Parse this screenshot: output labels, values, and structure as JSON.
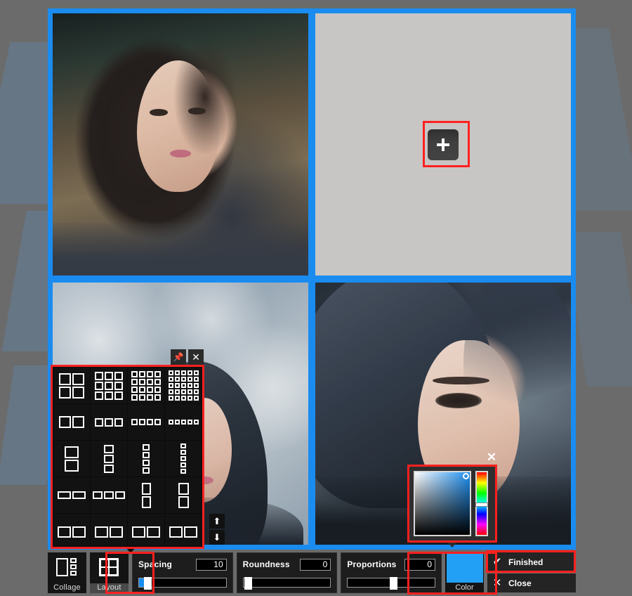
{
  "app": {
    "canvas_bg": "#6b6b6b",
    "spacing_color": "#1a8cf0",
    "highlight_color": "#ff2020"
  },
  "collage": {
    "cells": [
      {
        "name": "photo-portrait-warm",
        "filled": true
      },
      {
        "name": "empty-slot",
        "filled": false,
        "add_label": "+"
      },
      {
        "name": "photo-hooded-wall",
        "filled": true
      },
      {
        "name": "photo-hooded-closeup",
        "filled": true
      }
    ]
  },
  "toolbar": {
    "collage": {
      "label": "Collage",
      "icon": "collage-icon",
      "selected": false
    },
    "layout": {
      "label": "Layout",
      "icon": "layout-grid-icon",
      "selected": true
    },
    "sliders": [
      {
        "name": "spacing",
        "label": "Spacing",
        "value": "10",
        "fill_pct": 4,
        "thumb_pct": 4
      },
      {
        "name": "roundness",
        "label": "Roundness",
        "value": "0",
        "fill_pct": 0,
        "thumb_pct": 0
      },
      {
        "name": "proportions",
        "label": "Proportions",
        "value": "0",
        "fill_pct": 0,
        "thumb_pct": 50
      }
    ],
    "color": {
      "label": "Color",
      "swatch": "#22a0f5"
    },
    "finished": {
      "label": "Finished",
      "glyph": "✔"
    },
    "close": {
      "label": "Close",
      "glyph": "✕"
    }
  },
  "layout_popup": {
    "pin_glyph": "📌",
    "close_glyph": "✕",
    "scroll_up_glyph": "⬆",
    "scroll_down_glyph": "⬇",
    "templates": [
      {
        "name": "grid-2x2",
        "cols": 2,
        "rows": 2,
        "cw": 17,
        "ch": 17
      },
      {
        "name": "grid-3x3",
        "cols": 3,
        "rows": 3,
        "cw": 12,
        "ch": 12
      },
      {
        "name": "grid-4x4",
        "cols": 4,
        "rows": 4,
        "cw": 9,
        "ch": 9
      },
      {
        "name": "grid-5x5",
        "cols": 5,
        "rows": 5,
        "cw": 7,
        "ch": 7
      },
      {
        "name": "cols-2",
        "cols": 2,
        "rows": 1,
        "cw": 17,
        "ch": 17
      },
      {
        "name": "cols-3",
        "cols": 3,
        "rows": 1,
        "cw": 12,
        "ch": 12
      },
      {
        "name": "cols-4",
        "cols": 4,
        "rows": 1,
        "cw": 9,
        "ch": 9
      },
      {
        "name": "cols-5",
        "cols": 5,
        "rows": 1,
        "cw": 7,
        "ch": 7
      },
      {
        "name": "rows-2",
        "cols": 1,
        "rows": 2,
        "cw": 20,
        "ch": 17
      },
      {
        "name": "rows-3",
        "cols": 1,
        "rows": 3,
        "cw": 14,
        "ch": 12
      },
      {
        "name": "rows-4",
        "cols": 1,
        "rows": 4,
        "cw": 10,
        "ch": 9
      },
      {
        "name": "rows-5",
        "cols": 1,
        "rows": 5,
        "cw": 8,
        "ch": 7
      },
      {
        "name": "wide-cols-2",
        "cols": 2,
        "rows": 1,
        "cw": 19,
        "ch": 11
      },
      {
        "name": "wide-cols-3",
        "cols": 3,
        "rows": 1,
        "cw": 14,
        "ch": 11
      },
      {
        "name": "tall-rows-2",
        "cols": 1,
        "rows": 2,
        "cw": 13,
        "ch": 17
      },
      {
        "name": "tall-rows-2b",
        "cols": 1,
        "rows": 2,
        "cw": 15,
        "ch": 17
      },
      {
        "name": "partial-a",
        "cols": 2,
        "rows": 1,
        "cw": 19,
        "ch": 16
      },
      {
        "name": "partial-b",
        "cols": 2,
        "rows": 1,
        "cw": 19,
        "ch": 16
      },
      {
        "name": "partial-c",
        "cols": 2,
        "rows": 1,
        "cw": 19,
        "ch": 16
      },
      {
        "name": "partial-d",
        "cols": 2,
        "rows": 1,
        "cw": 19,
        "ch": 16
      }
    ]
  },
  "color_popup": {
    "close_glyph": "✕",
    "hue_hex": "#1f90f0",
    "selected_hex": "#22a0f5"
  }
}
